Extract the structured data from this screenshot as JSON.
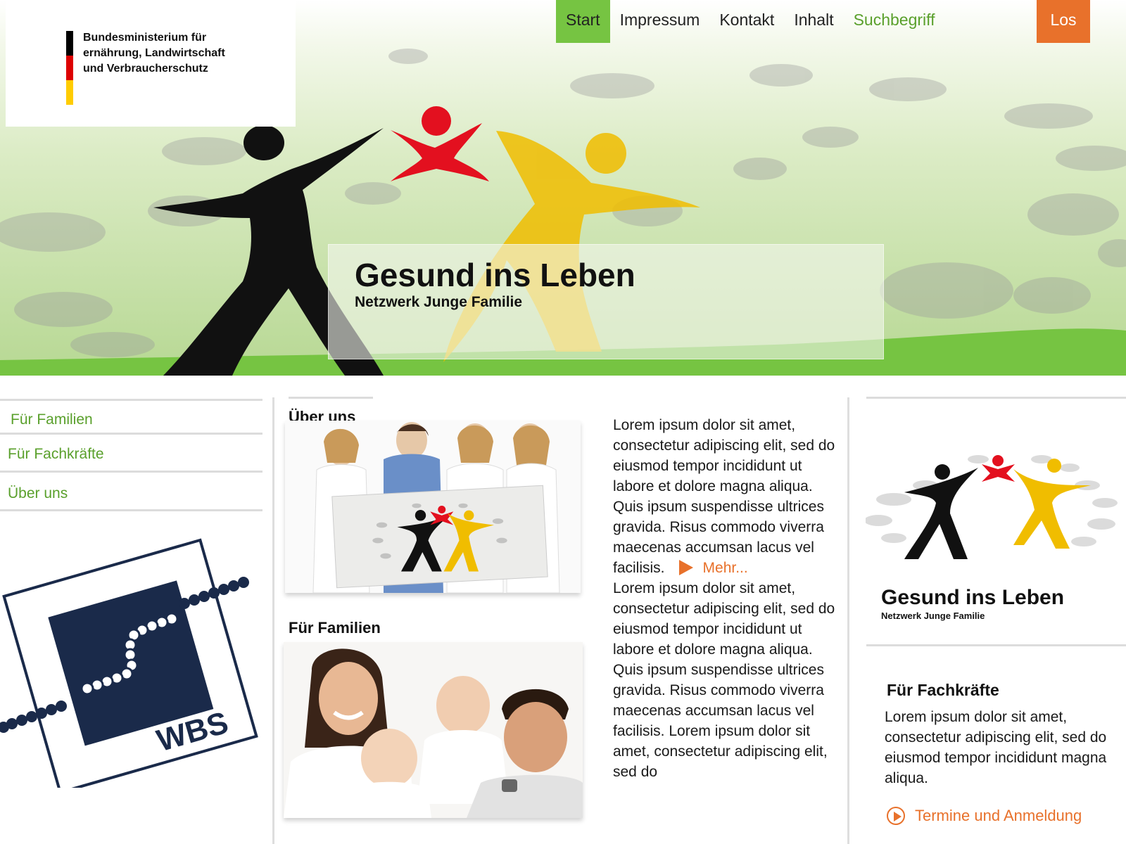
{
  "brand": {
    "ministry_line1": "Bundesministerium für",
    "ministry_line2": "ernährung, Landwirtschaft",
    "ministry_line3": "und Verbraucherschutz",
    "flag_colors": [
      "#000000",
      "#dd0000",
      "#ffcc00"
    ]
  },
  "nav": {
    "items": [
      "Start",
      "Impressum",
      "Kontakt",
      "Inhalt"
    ],
    "active": "Start",
    "search_placeholder": "Suchbegriff",
    "search_button": "Los"
  },
  "hero": {
    "title": "Gesund ins Leben",
    "subtitle": "Netzwerk Junge Familie"
  },
  "sidebar": {
    "items": [
      "Für Familien",
      "Für Fachkräfte",
      "Über uns"
    ],
    "logo_text": "WBS"
  },
  "main": {
    "sections": [
      {
        "title": "Über uns",
        "image": "group-photo-with-logo-banner"
      },
      {
        "title": "Für Familien",
        "image": "family-photo"
      }
    ],
    "text_part1": "Lorem ipsum dolor sit amet, consectetur adipiscing elit, sed do eiusmod tempor incididunt ut labore et dolore magna aliqua. Quis ipsum suspendisse ultrices gravida. Risus commodo viverra maecenas accumsan lacus vel facilisis.",
    "more_link": "Mehr...",
    "text_part2": "Lorem ipsum dolor sit amet, consectetur adipiscing elit, sed do eiusmod tempor incididunt ut labore et dolore magna aliqua. Quis ipsum suspendisse ultrices gravida. Risus commodo viverra maecenas accumsan lacus vel facilisis. Lorem ipsum dolor sit amet, consectetur adipiscing elit, sed do"
  },
  "right": {
    "logo_title": "Gesund ins Leben",
    "logo_subtitle": "Netzwerk Junge Familie",
    "fachkraefte_title": "Für Fachkräfte",
    "fachkraefte_text": "Lorem ipsum dolor sit amet, consectetur adipiscing elit, sed do eiusmod tempor incididunt magna aliqua.",
    "termine_link": "Termine und Anmeldung"
  },
  "colors": {
    "accent_green": "#76c442",
    "link_green": "#5aa02c",
    "accent_orange": "#e8712b",
    "figure_black": "#111111",
    "figure_red": "#e3101f",
    "figure_yellow": "#f0bd00"
  }
}
